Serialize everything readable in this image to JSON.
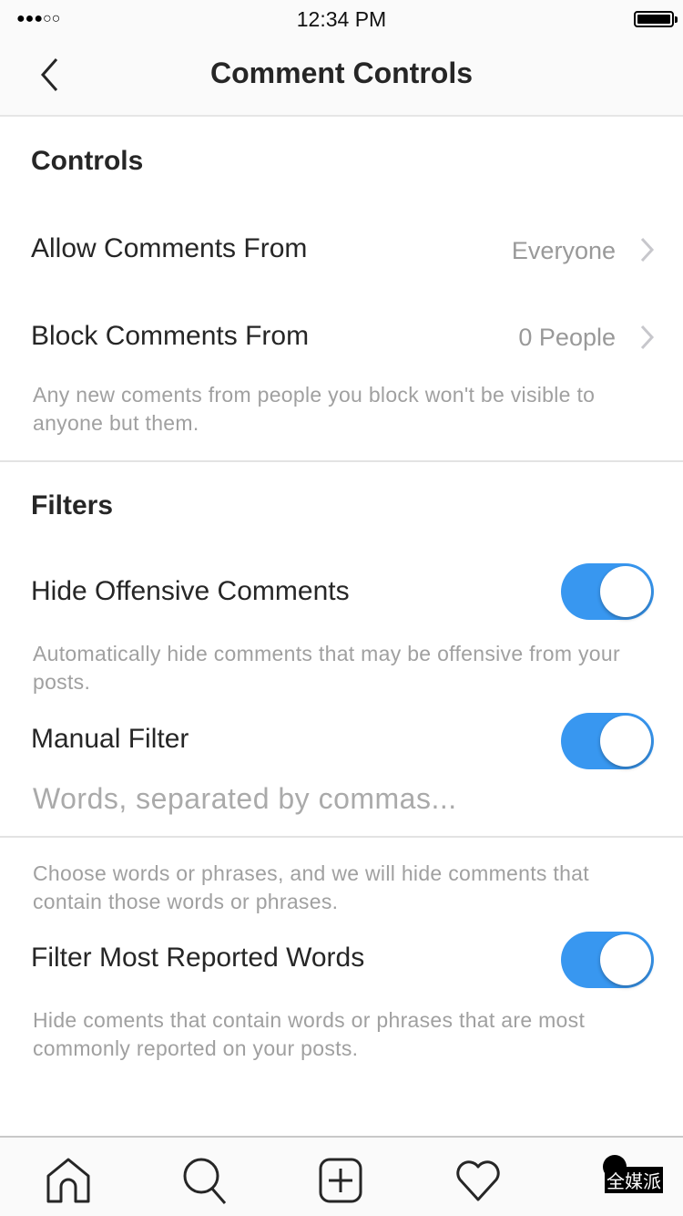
{
  "status_bar": {
    "signal": "●●●○○",
    "time": "12:34 PM",
    "battery_level": 1.0
  },
  "header": {
    "title": "Comment Controls",
    "back_icon": "chevron-left-icon"
  },
  "controls": {
    "heading": "Controls",
    "allow": {
      "label": "Allow Comments From",
      "value": "Everyone"
    },
    "block": {
      "label": "Block Comments From",
      "value": "0 People"
    },
    "block_desc": "Any new coments from people you block won't be visible to anyone but them."
  },
  "filters": {
    "heading": "Filters",
    "hide_offensive": {
      "label": "Hide Offensive Comments",
      "on": true,
      "desc": "Automatically hide comments that may be offensive from your posts."
    },
    "manual": {
      "label": "Manual Filter",
      "on": true,
      "placeholder": "Words, separated by commas...",
      "desc": "Choose words or phrases, and we will hide comments that contain those words or phrases."
    },
    "most_reported": {
      "label": "Filter Most Reported Words",
      "on": true,
      "desc": "Hide coments that contain words or phrases that are most commonly reported on your posts."
    },
    "toggle_color": "#3897f0"
  },
  "tabbar": {
    "icons": [
      "home-icon",
      "search-icon",
      "add-post-icon",
      "heart-icon",
      "profile-icon"
    ]
  },
  "watermark": "全媒派"
}
